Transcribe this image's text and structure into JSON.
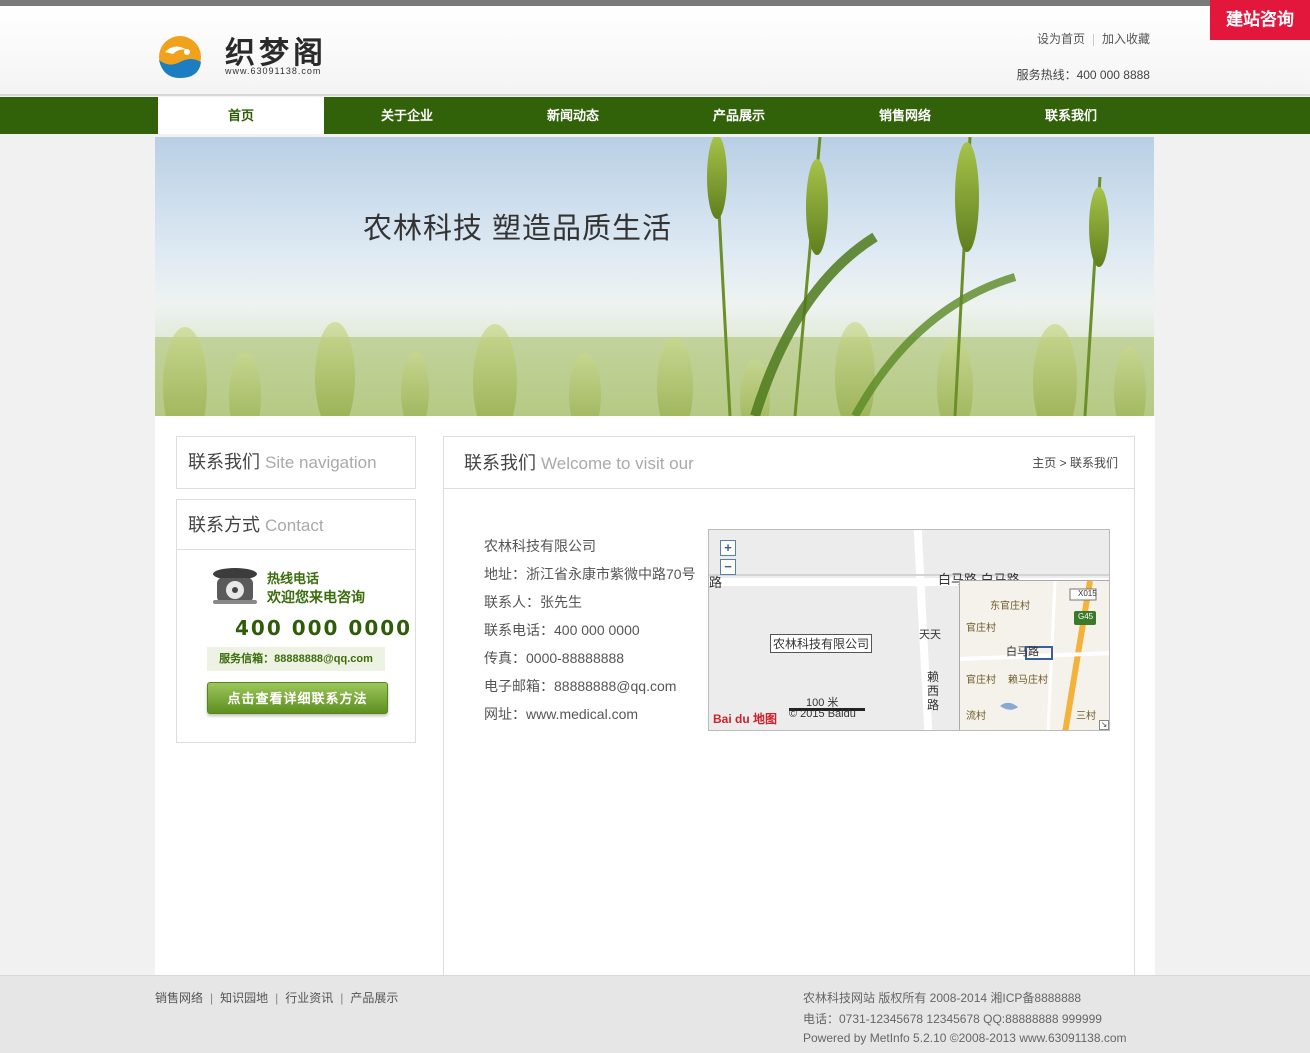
{
  "header": {
    "logo_text": "织梦阁",
    "logo_sub": "www.63091138.com",
    "links": [
      "设为首页",
      "加入收藏"
    ],
    "hotline": "服务热线：400 000 8888",
    "consult": "建站咨询"
  },
  "nav": {
    "items": [
      "首页",
      "关于企业",
      "新闻动态",
      "产品展示",
      "销售网络",
      "联系我们"
    ],
    "active": "首页"
  },
  "banner": {
    "title": "农林科技  塑造品质生活"
  },
  "sidebar": {
    "nav_box": {
      "title": "联系我们",
      "title_en": "Site navigation"
    },
    "contact_box": {
      "title": "联系方式",
      "title_en": "Contact",
      "hot_label": "热线电话",
      "welcome": "欢迎您来电咨询",
      "phone": "400 000 0000",
      "email_strip": "服务信箱：88888888@qq.com",
      "detail_button": "点击查看详细联系方法"
    }
  },
  "main": {
    "title": "联系我们",
    "title_en": "Welcome to visit our",
    "breadcrumb": {
      "home": "主页",
      "sep": ">",
      "current": "联系我们"
    },
    "info": [
      "农林科技有限公司",
      "地址：浙江省永康市紫微中路70号",
      "联系人：张先生",
      "联系电话：400 000 0000",
      "传真：0000-88888888",
      "电子邮箱：88888888@qq.com",
      "网址：www.medical.com"
    ],
    "map": {
      "zoom_in": "+",
      "zoom_out": "−",
      "marker": "农林科技有限公司",
      "road_a": "白马路  白马路",
      "road_left": "路",
      "tiantian": "天天",
      "road_v": "赖西路",
      "scale": "100 米",
      "copyright": "© 2015 Baidu",
      "baidu_logo": "Bai du 地图",
      "mini": [
        "东官庄村",
        "官庄村",
        "白马路",
        "官庄村",
        "赖马庄村",
        "流村",
        "三村"
      ],
      "badges": [
        "X015",
        "G45"
      ]
    }
  },
  "footer": {
    "links": [
      "销售网络",
      "知识园地",
      "行业资讯",
      "产品展示"
    ],
    "copyright": "农林科技网站 版权所有 2008-2014 湘ICP备8888888",
    "contact": "电话：0731-12345678 12345678 QQ:88888888 999999",
    "powered": "Powered by MetInfo 5.2.10 ©2008-2013 www.63091138.com"
  },
  "colors": {
    "nav_green": "#316108",
    "consult_red": "#e3163c",
    "accent_green": "#3b6d0d"
  }
}
